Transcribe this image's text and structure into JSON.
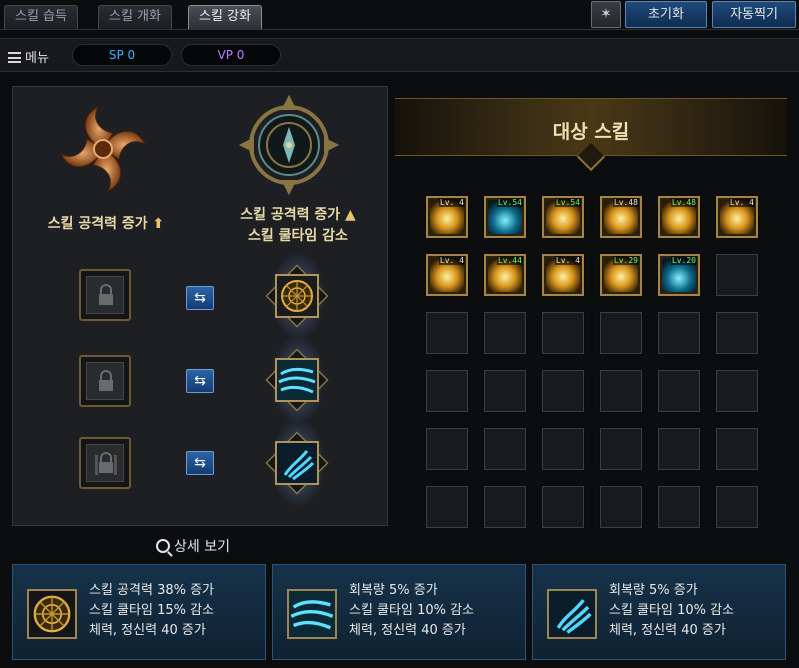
{
  "tabs": [
    {
      "label": "스킬 습득",
      "active": false
    },
    {
      "label": "스킬 개화",
      "active": false
    },
    {
      "label": "스킬 강화",
      "active": true
    }
  ],
  "top_buttons": {
    "reset": "초기화",
    "auto_assign": "자동찍기",
    "pin_icon": "pin-icon"
  },
  "menubar": {
    "menu_label": "메뉴",
    "sp": "SP 0",
    "vp": "VP 0"
  },
  "left": {
    "left_title": "스킬 공격력 증가",
    "right_title_line1": "스킬 공격력 증가",
    "right_title_line2": "스킬 쿨타임 감소",
    "detail_label": "상세 보기",
    "swap_icon": "swap-arrows-icon",
    "rows": [
      {
        "locked_icon": "lock-icon",
        "skill_icon": "golden-wheel-icon"
      },
      {
        "locked_icon": "lock-icon",
        "skill_icon": "cyan-wave-icon"
      },
      {
        "locked_icon": "lock-icon",
        "skill_icon": "cyan-claw-icon"
      }
    ]
  },
  "target": {
    "title": "대상 스킬",
    "skills": [
      {
        "level": "Lv. 4",
        "level_color": "white",
        "theme": "gold"
      },
      {
        "level": "Lv.54",
        "level_color": "green",
        "theme": "blue"
      },
      {
        "level": "Lv.54",
        "level_color": "green",
        "theme": "gold"
      },
      {
        "level": "Lv.48",
        "level_color": "white",
        "theme": "gold"
      },
      {
        "level": "Lv.48",
        "level_color": "green",
        "theme": "gold"
      },
      {
        "level": "Lv. 4",
        "level_color": "white",
        "theme": "gold"
      },
      {
        "level": "Lv. 4",
        "level_color": "white",
        "theme": "gold"
      },
      {
        "level": "Lv.44",
        "level_color": "green",
        "theme": "gold"
      },
      {
        "level": "Lv. 4",
        "level_color": "white",
        "theme": "gold"
      },
      {
        "level": "Lv.29",
        "level_color": "green",
        "theme": "gold"
      },
      {
        "level": "Lv.20",
        "level_color": "green",
        "theme": "blue"
      }
    ],
    "total_slots": 36
  },
  "cards": [
    {
      "icon": "golden-wheel-icon",
      "lines": [
        "스킬 공격력 38% 증가",
        "스킬 쿨타임 15% 감소",
        "체력, 정신력 40 증가"
      ]
    },
    {
      "icon": "cyan-wave-icon",
      "lines": [
        "회복량 5% 증가",
        "스킬 쿨타임 10% 감소",
        "체력, 정신력 40 증가"
      ]
    },
    {
      "icon": "cyan-claw-icon",
      "lines": [
        "회복량 5% 증가",
        "스킬 쿨타임 10% 감소",
        "체력, 정신력 40 증가"
      ]
    }
  ],
  "colors": {
    "accent_gold": "#b0925a",
    "sp_blue": "#37b6ff",
    "vp_purple": "#b97cff",
    "button_blue": "#1f4a7a"
  }
}
